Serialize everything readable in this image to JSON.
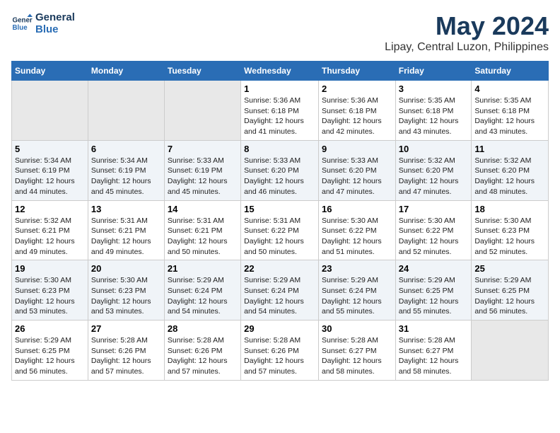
{
  "logo": {
    "line1": "General",
    "line2": "Blue"
  },
  "title": "May 2024",
  "subtitle": "Lipay, Central Luzon, Philippines",
  "days": [
    "Sunday",
    "Monday",
    "Tuesday",
    "Wednesday",
    "Thursday",
    "Friday",
    "Saturday"
  ],
  "weeks": [
    [
      {
        "num": "",
        "text": ""
      },
      {
        "num": "",
        "text": ""
      },
      {
        "num": "",
        "text": ""
      },
      {
        "num": "1",
        "text": "Sunrise: 5:36 AM\nSunset: 6:18 PM\nDaylight: 12 hours and 41 minutes."
      },
      {
        "num": "2",
        "text": "Sunrise: 5:36 AM\nSunset: 6:18 PM\nDaylight: 12 hours and 42 minutes."
      },
      {
        "num": "3",
        "text": "Sunrise: 5:35 AM\nSunset: 6:18 PM\nDaylight: 12 hours and 43 minutes."
      },
      {
        "num": "4",
        "text": "Sunrise: 5:35 AM\nSunset: 6:18 PM\nDaylight: 12 hours and 43 minutes."
      }
    ],
    [
      {
        "num": "5",
        "text": "Sunrise: 5:34 AM\nSunset: 6:19 PM\nDaylight: 12 hours and 44 minutes."
      },
      {
        "num": "6",
        "text": "Sunrise: 5:34 AM\nSunset: 6:19 PM\nDaylight: 12 hours and 45 minutes."
      },
      {
        "num": "7",
        "text": "Sunrise: 5:33 AM\nSunset: 6:19 PM\nDaylight: 12 hours and 45 minutes."
      },
      {
        "num": "8",
        "text": "Sunrise: 5:33 AM\nSunset: 6:20 PM\nDaylight: 12 hours and 46 minutes."
      },
      {
        "num": "9",
        "text": "Sunrise: 5:33 AM\nSunset: 6:20 PM\nDaylight: 12 hours and 47 minutes."
      },
      {
        "num": "10",
        "text": "Sunrise: 5:32 AM\nSunset: 6:20 PM\nDaylight: 12 hours and 47 minutes."
      },
      {
        "num": "11",
        "text": "Sunrise: 5:32 AM\nSunset: 6:20 PM\nDaylight: 12 hours and 48 minutes."
      }
    ],
    [
      {
        "num": "12",
        "text": "Sunrise: 5:32 AM\nSunset: 6:21 PM\nDaylight: 12 hours and 49 minutes."
      },
      {
        "num": "13",
        "text": "Sunrise: 5:31 AM\nSunset: 6:21 PM\nDaylight: 12 hours and 49 minutes."
      },
      {
        "num": "14",
        "text": "Sunrise: 5:31 AM\nSunset: 6:21 PM\nDaylight: 12 hours and 50 minutes."
      },
      {
        "num": "15",
        "text": "Sunrise: 5:31 AM\nSunset: 6:22 PM\nDaylight: 12 hours and 50 minutes."
      },
      {
        "num": "16",
        "text": "Sunrise: 5:30 AM\nSunset: 6:22 PM\nDaylight: 12 hours and 51 minutes."
      },
      {
        "num": "17",
        "text": "Sunrise: 5:30 AM\nSunset: 6:22 PM\nDaylight: 12 hours and 52 minutes."
      },
      {
        "num": "18",
        "text": "Sunrise: 5:30 AM\nSunset: 6:23 PM\nDaylight: 12 hours and 52 minutes."
      }
    ],
    [
      {
        "num": "19",
        "text": "Sunrise: 5:30 AM\nSunset: 6:23 PM\nDaylight: 12 hours and 53 minutes."
      },
      {
        "num": "20",
        "text": "Sunrise: 5:30 AM\nSunset: 6:23 PM\nDaylight: 12 hours and 53 minutes."
      },
      {
        "num": "21",
        "text": "Sunrise: 5:29 AM\nSunset: 6:24 PM\nDaylight: 12 hours and 54 minutes."
      },
      {
        "num": "22",
        "text": "Sunrise: 5:29 AM\nSunset: 6:24 PM\nDaylight: 12 hours and 54 minutes."
      },
      {
        "num": "23",
        "text": "Sunrise: 5:29 AM\nSunset: 6:24 PM\nDaylight: 12 hours and 55 minutes."
      },
      {
        "num": "24",
        "text": "Sunrise: 5:29 AM\nSunset: 6:25 PM\nDaylight: 12 hours and 55 minutes."
      },
      {
        "num": "25",
        "text": "Sunrise: 5:29 AM\nSunset: 6:25 PM\nDaylight: 12 hours and 56 minutes."
      }
    ],
    [
      {
        "num": "26",
        "text": "Sunrise: 5:29 AM\nSunset: 6:25 PM\nDaylight: 12 hours and 56 minutes."
      },
      {
        "num": "27",
        "text": "Sunrise: 5:28 AM\nSunset: 6:26 PM\nDaylight: 12 hours and 57 minutes."
      },
      {
        "num": "28",
        "text": "Sunrise: 5:28 AM\nSunset: 6:26 PM\nDaylight: 12 hours and 57 minutes."
      },
      {
        "num": "29",
        "text": "Sunrise: 5:28 AM\nSunset: 6:26 PM\nDaylight: 12 hours and 57 minutes."
      },
      {
        "num": "30",
        "text": "Sunrise: 5:28 AM\nSunset: 6:27 PM\nDaylight: 12 hours and 58 minutes."
      },
      {
        "num": "31",
        "text": "Sunrise: 5:28 AM\nSunset: 6:27 PM\nDaylight: 12 hours and 58 minutes."
      },
      {
        "num": "",
        "text": ""
      }
    ]
  ]
}
